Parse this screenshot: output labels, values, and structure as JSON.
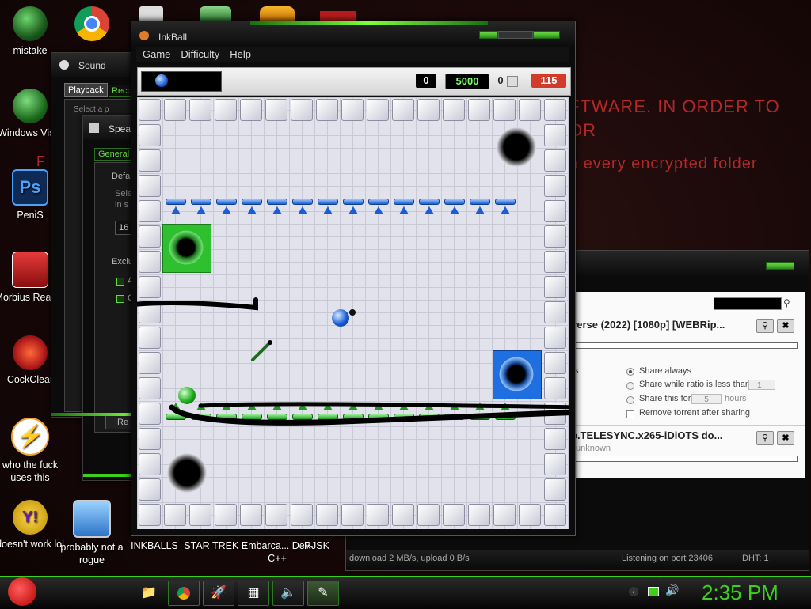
{
  "desktop_text": {
    "line1": "FTWARE. IN ORDER TO",
    "line2": "OR",
    "line3": "n every encrypted folder",
    "partial_f": "F"
  },
  "desktop_icons": [
    {
      "label": "mistake",
      "icon": "green-orb-icon"
    },
    {
      "label": "Windows Vista",
      "icon": "recycle-bin-icon"
    },
    {
      "label": "PeniS",
      "icon": "photoshop-icon"
    },
    {
      "label": "Morbius Reader",
      "icon": "pdf-reader-icon"
    },
    {
      "label": "CockClear",
      "icon": "broom-icon"
    },
    {
      "label": "who the fuck uses this",
      "icon": "lightning-icon"
    },
    {
      "label": "doesn't work lol",
      "icon": "yahoo-icon"
    },
    {
      "label": "probably not a rogue",
      "icon": "monitor-gear-icon"
    },
    {
      "label": "INKBALLS",
      "icon": "inkball-icon"
    },
    {
      "label": "STAR TREK 3",
      "icon": "startrek-icon"
    },
    {
      "label": "Embarca... Dev-C++",
      "icon": "devcpp-icon"
    },
    {
      "label": "RJSK",
      "icon": "rjsk-icon"
    }
  ],
  "sound_window": {
    "title": "Sound",
    "tabs": [
      "Playback",
      "Reco"
    ],
    "sub_title": "Spea",
    "sub_tab": "General",
    "default_label": "Defa",
    "select_line1": "Sele",
    "select_line2": "in s",
    "field_value": "16",
    "exclusive_label": "Exclu",
    "check1": "A",
    "check2": "G",
    "reset_button": "Re",
    "top_hint": "Select a p"
  },
  "inkball": {
    "title": "InkBall",
    "menu": [
      "Game",
      "Difficulty",
      "Help"
    ],
    "score_left": "0",
    "score_main": "5000",
    "balls_count": "0",
    "time_remaining": "115"
  },
  "torrent": {
    "item1_title": "verse (2022) [1080p] [WEBRip...",
    "share_always": "Share always",
    "share_ratio": "Share while ratio is less than",
    "share_ratio_value": "1",
    "share_for": "Share this for",
    "share_for_value": "5",
    "share_for_unit": "hours",
    "remove_torrent": "Remove torrent after sharing",
    "left_fragment": "s",
    "item2_title": "o.TELESYNC.x265-iDiOTS do...",
    "item2_status": "unknown",
    "status_left": "download 2 MB/s, upload 0 B/s",
    "status_port": "Listening on port 23406",
    "status_dht": "DHT: 1"
  },
  "taskbar": {
    "clock": "2:35 PM"
  },
  "colors": {
    "accent_green": "#3bd11c",
    "desktop_red_text": "#b0282a",
    "time_red": "#d23a2a"
  }
}
